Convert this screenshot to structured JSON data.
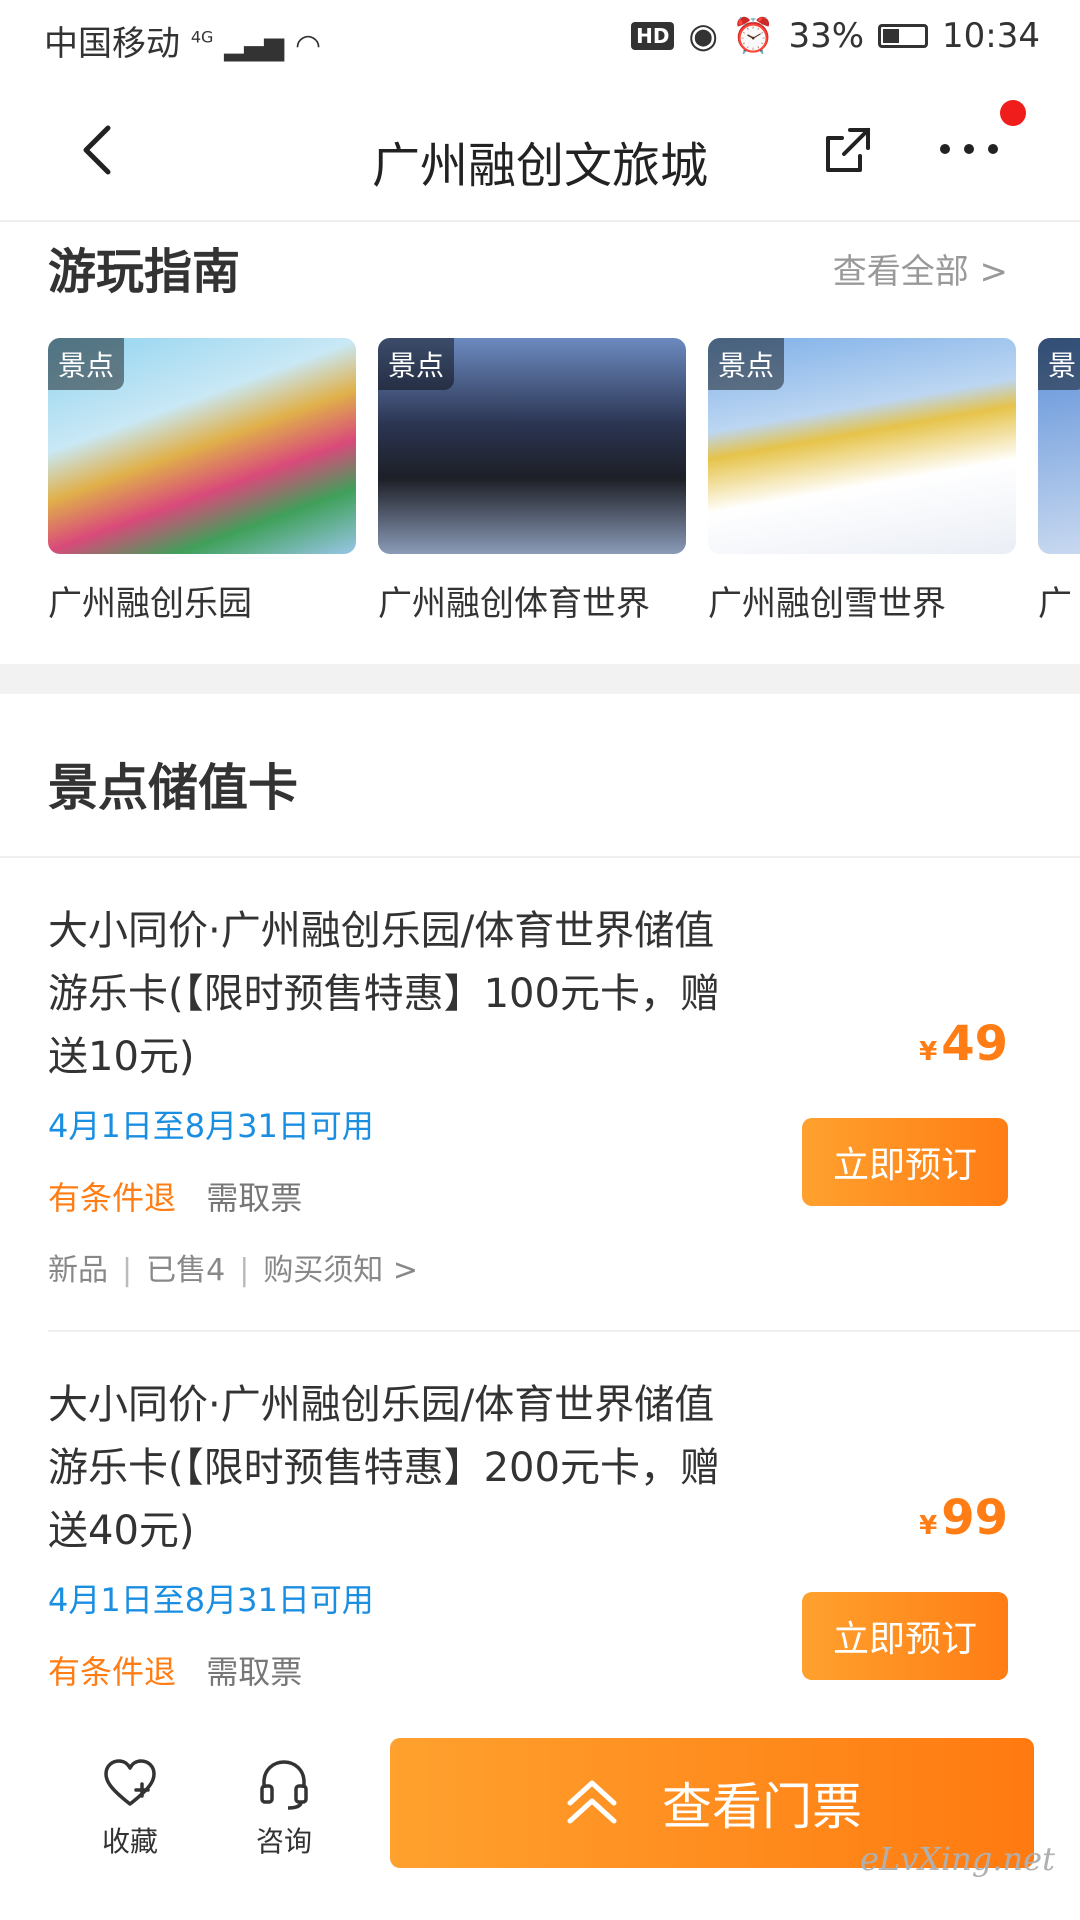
{
  "status_bar": {
    "carrier": "中国移动",
    "network": "4G",
    "hd": "HD",
    "battery": "33%",
    "time": "10:34"
  },
  "nav": {
    "title": "广州融创文旅城"
  },
  "guide": {
    "title": "游玩指南",
    "view_all": "查看全部 >",
    "cards": [
      {
        "tag": "景点",
        "name": "广州融创乐园"
      },
      {
        "tag": "景点",
        "name": "广州融创体育世界"
      },
      {
        "tag": "景点",
        "name": "广州融创雪世界"
      },
      {
        "tag": "景",
        "name": "广"
      }
    ]
  },
  "stored_value": {
    "title": "景点储值卡",
    "products": [
      {
        "name": "大小同价·广州融创乐园/体育世界储值游乐卡(【限时预售特惠】100元卡，赠送10元)",
        "date": "4月1日至8月31日可用",
        "refund": "有条件退",
        "ticket": "需取票",
        "meta_new": "新品",
        "meta_sold": "已售4",
        "meta_notice": "购买须知 >",
        "currency": "¥",
        "price": "49",
        "button": "立即预订"
      },
      {
        "name": "大小同价·广州融创乐园/体育世界储值游乐卡(【限时预售特惠】200元卡，赠送40元)",
        "date": "4月1日至8月31日可用",
        "refund": "有条件退",
        "ticket": "需取票",
        "currency": "¥",
        "price": "99",
        "button": "立即预订"
      }
    ]
  },
  "bottom_bar": {
    "favorite": "收藏",
    "consult": "咨询",
    "tickets": "查看门票"
  },
  "watermark": "eLvXing.net",
  "colors": {
    "accent": "#ff7d14",
    "date_blue": "#1a8ee0",
    "notification": "#f01d1d"
  }
}
